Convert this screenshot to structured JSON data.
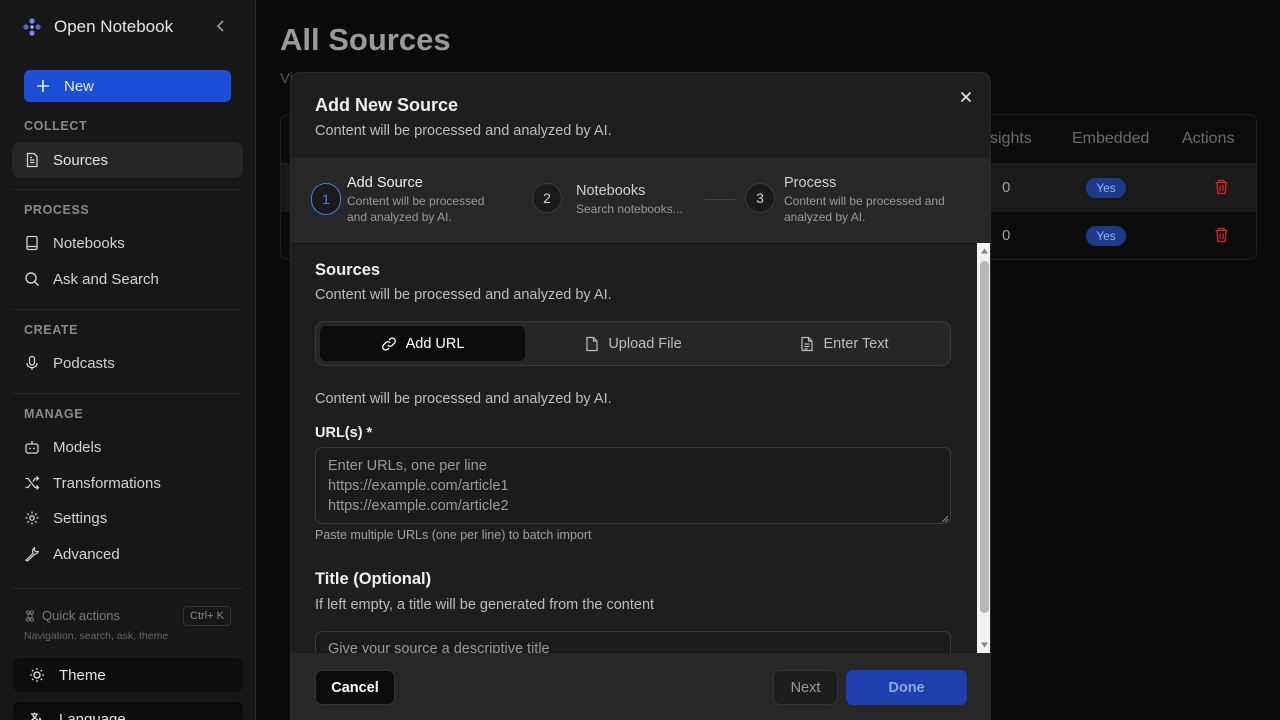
{
  "sidebar": {
    "brand": "Open Notebook",
    "new_label": "New",
    "sections": {
      "collect": "COLLECT",
      "process": "PROCESS",
      "create": "CREATE",
      "manage": "MANAGE"
    },
    "items": {
      "sources": "Sources",
      "notebooks": "Notebooks",
      "ask": "Ask and Search",
      "podcasts": "Podcasts",
      "models": "Models",
      "transformations": "Transformations",
      "settings": "Settings",
      "advanced": "Advanced"
    },
    "quick_actions": "Quick actions",
    "quick_shortcut": "Ctrl+ K",
    "quick_sub": "Navigation, search, ask, theme",
    "theme": "Theme",
    "language": "Language"
  },
  "main": {
    "title": "All Sources",
    "subtitle": "Vi",
    "columns": {
      "insights": "sights",
      "embedded": "Embedded",
      "actions": "Actions"
    },
    "rows": [
      {
        "insights": "0",
        "embedded": "Yes"
      },
      {
        "insights": "0",
        "embedded": "Yes"
      }
    ]
  },
  "dialog": {
    "title": "Add New Source",
    "description": "Content will be processed and analyzed by AI.",
    "steps": [
      {
        "num": "1",
        "title": "Add Source",
        "desc": "Content will be processed and analyzed by AI."
      },
      {
        "num": "2",
        "title": "Notebooks",
        "desc": "Search notebooks..."
      },
      {
        "num": "3",
        "title": "Process",
        "desc": "Content will be processed and analyzed by AI."
      }
    ],
    "sources_title": "Sources",
    "sources_desc": "Content will be processed and analyzed by AI.",
    "tabs": {
      "url": "Add URL",
      "upload": "Upload File",
      "text": "Enter Text"
    },
    "url_desc": "Content will be processed and analyzed by AI.",
    "url_label": "URL(s) *",
    "url_placeholder": "Enter URLs, one per line\nhttps://example.com/article1\nhttps://example.com/article2",
    "url_hint": "Paste multiple URLs (one per line) to batch import",
    "title_label": "Title (Optional)",
    "title_desc": "If left empty, a title will be generated from the content",
    "title_placeholder": "Give your source a descriptive title",
    "cancel": "Cancel",
    "next": "Next",
    "done": "Done"
  },
  "colors": {
    "accent": "#1d4ed8",
    "step_active": "#3b82f6",
    "danger": "#dc2626"
  }
}
